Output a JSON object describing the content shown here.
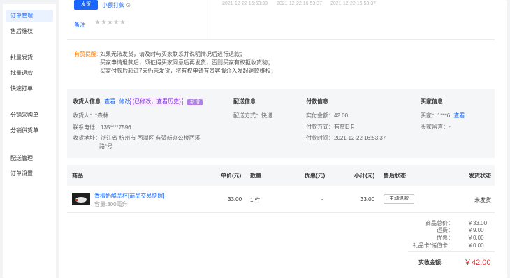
{
  "sidebar": {
    "items": [
      {
        "label": "订单管理",
        "active": true
      },
      {
        "label": "售后维权",
        "active": false
      },
      {
        "label": "批量发货",
        "active": false
      },
      {
        "label": "批量退款",
        "active": false
      },
      {
        "label": "快速打单",
        "active": false
      },
      {
        "label": "分销采购单",
        "active": false
      },
      {
        "label": "分销供货单",
        "active": false
      },
      {
        "label": "配送管理",
        "active": false
      },
      {
        "label": "订单设置",
        "active": false
      }
    ]
  },
  "top": {
    "send_button": "发货",
    "store_link": "小额打款",
    "timestamps": [
      "2021-12-22 16:53:33",
      "2021-12-22 16:53:37",
      "2021-12-22 16:53:37"
    ],
    "remark_label": "备注",
    "rating_stars": 5
  },
  "notice": {
    "label": "有赞提醒:",
    "lines": [
      "如果无法发货，请及时与买家联系并说明情况后进行退款；",
      "买家申请退款后，须征得买家同意后再发货，否则买家有权拒收货物；",
      "买家付款后超过7天仍未发货，将有权申请有赞客服介入发起退款维权；"
    ]
  },
  "receiver": {
    "title": "收货人信息",
    "view_link": "查看",
    "edit_link": "修改",
    "modified_tag": "(已修改，",
    "history_link": "查看历史)",
    "new_badge": "新增",
    "name": "收货人：*森林",
    "phone": "联系电话：135****7596",
    "address_line1": "收货地址：浙江省 杭州市 西湖区 有赞新办公楼西溪",
    "address_line2": "路*号"
  },
  "delivery": {
    "title": "配送信息",
    "method": "配送方式：快递"
  },
  "payment": {
    "title": "付款信息",
    "amount": "实付金额：42.00",
    "method": "付款方式：有赞E卡",
    "time": "付款时间：2021-12-22 16:53:37"
  },
  "buyer": {
    "title": "买家信息",
    "buyer_label": "买家：1***6",
    "buyer_link": "查看",
    "message": "买家留言：-"
  },
  "table": {
    "headers": {
      "product": "商品",
      "unit_price": "单价(元)",
      "quantity": "数量",
      "discount": "优惠(元)",
      "subtotal": "小计(元)",
      "after_sale": "售后状态",
      "shipping": "发货状态"
    },
    "rows": [
      {
        "name": "香檀奶酪品杯[商品交易快照]",
        "spec": "容量:300毫升",
        "unit_price": "33.00",
        "quantity": "1 件",
        "discount": "-",
        "subtotal": "33.00",
        "action": "主动退款",
        "shipping_status": "未发货"
      }
    ]
  },
  "summary": {
    "rows": [
      {
        "label": "商品总价：",
        "value": "￥33.00"
      },
      {
        "label": "运费：",
        "value": "￥9.00"
      },
      {
        "label": "优惠：",
        "value": "￥0.00"
      },
      {
        "label": "礼品卡/储值卡：",
        "value": "￥0.00"
      }
    ],
    "total_label": "实收金额:",
    "total_value": "￥42.00"
  },
  "colors": {
    "accent": "#1966ff",
    "warning": "#ff7a00",
    "price_red": "#e8312f",
    "purple": "#b37feb"
  }
}
